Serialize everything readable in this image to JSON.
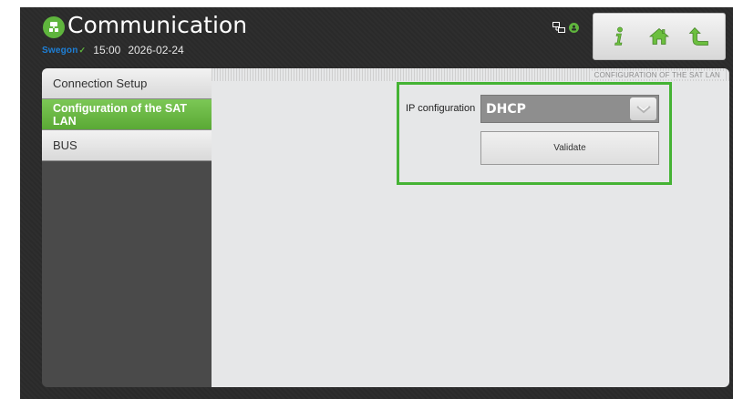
{
  "header": {
    "title": "Communication",
    "brand": "Swegon",
    "time": "15:00",
    "date": "2026-02-24"
  },
  "toolbar": {
    "buttons": [
      {
        "icon": "info-icon"
      },
      {
        "icon": "home-icon"
      },
      {
        "icon": "back-arrow-icon"
      }
    ]
  },
  "sidebar": {
    "items": [
      {
        "label": "Connection Setup",
        "active": false
      },
      {
        "label": "Configuration of the SAT LAN",
        "active": true
      },
      {
        "label": "BUS",
        "active": false
      }
    ]
  },
  "content": {
    "section_title": "CONFIGURATION OF THE SAT LAN",
    "ip_configuration_label": "IP configuration",
    "ip_configuration_value": "DHCP",
    "validate_label": "Validate"
  },
  "colors": {
    "accent_green": "#5fb53d",
    "highlight_green": "#45b334",
    "brand_blue": "#1e7fd6",
    "background": "#2b2b2b",
    "panel": "#e6e7e8"
  }
}
